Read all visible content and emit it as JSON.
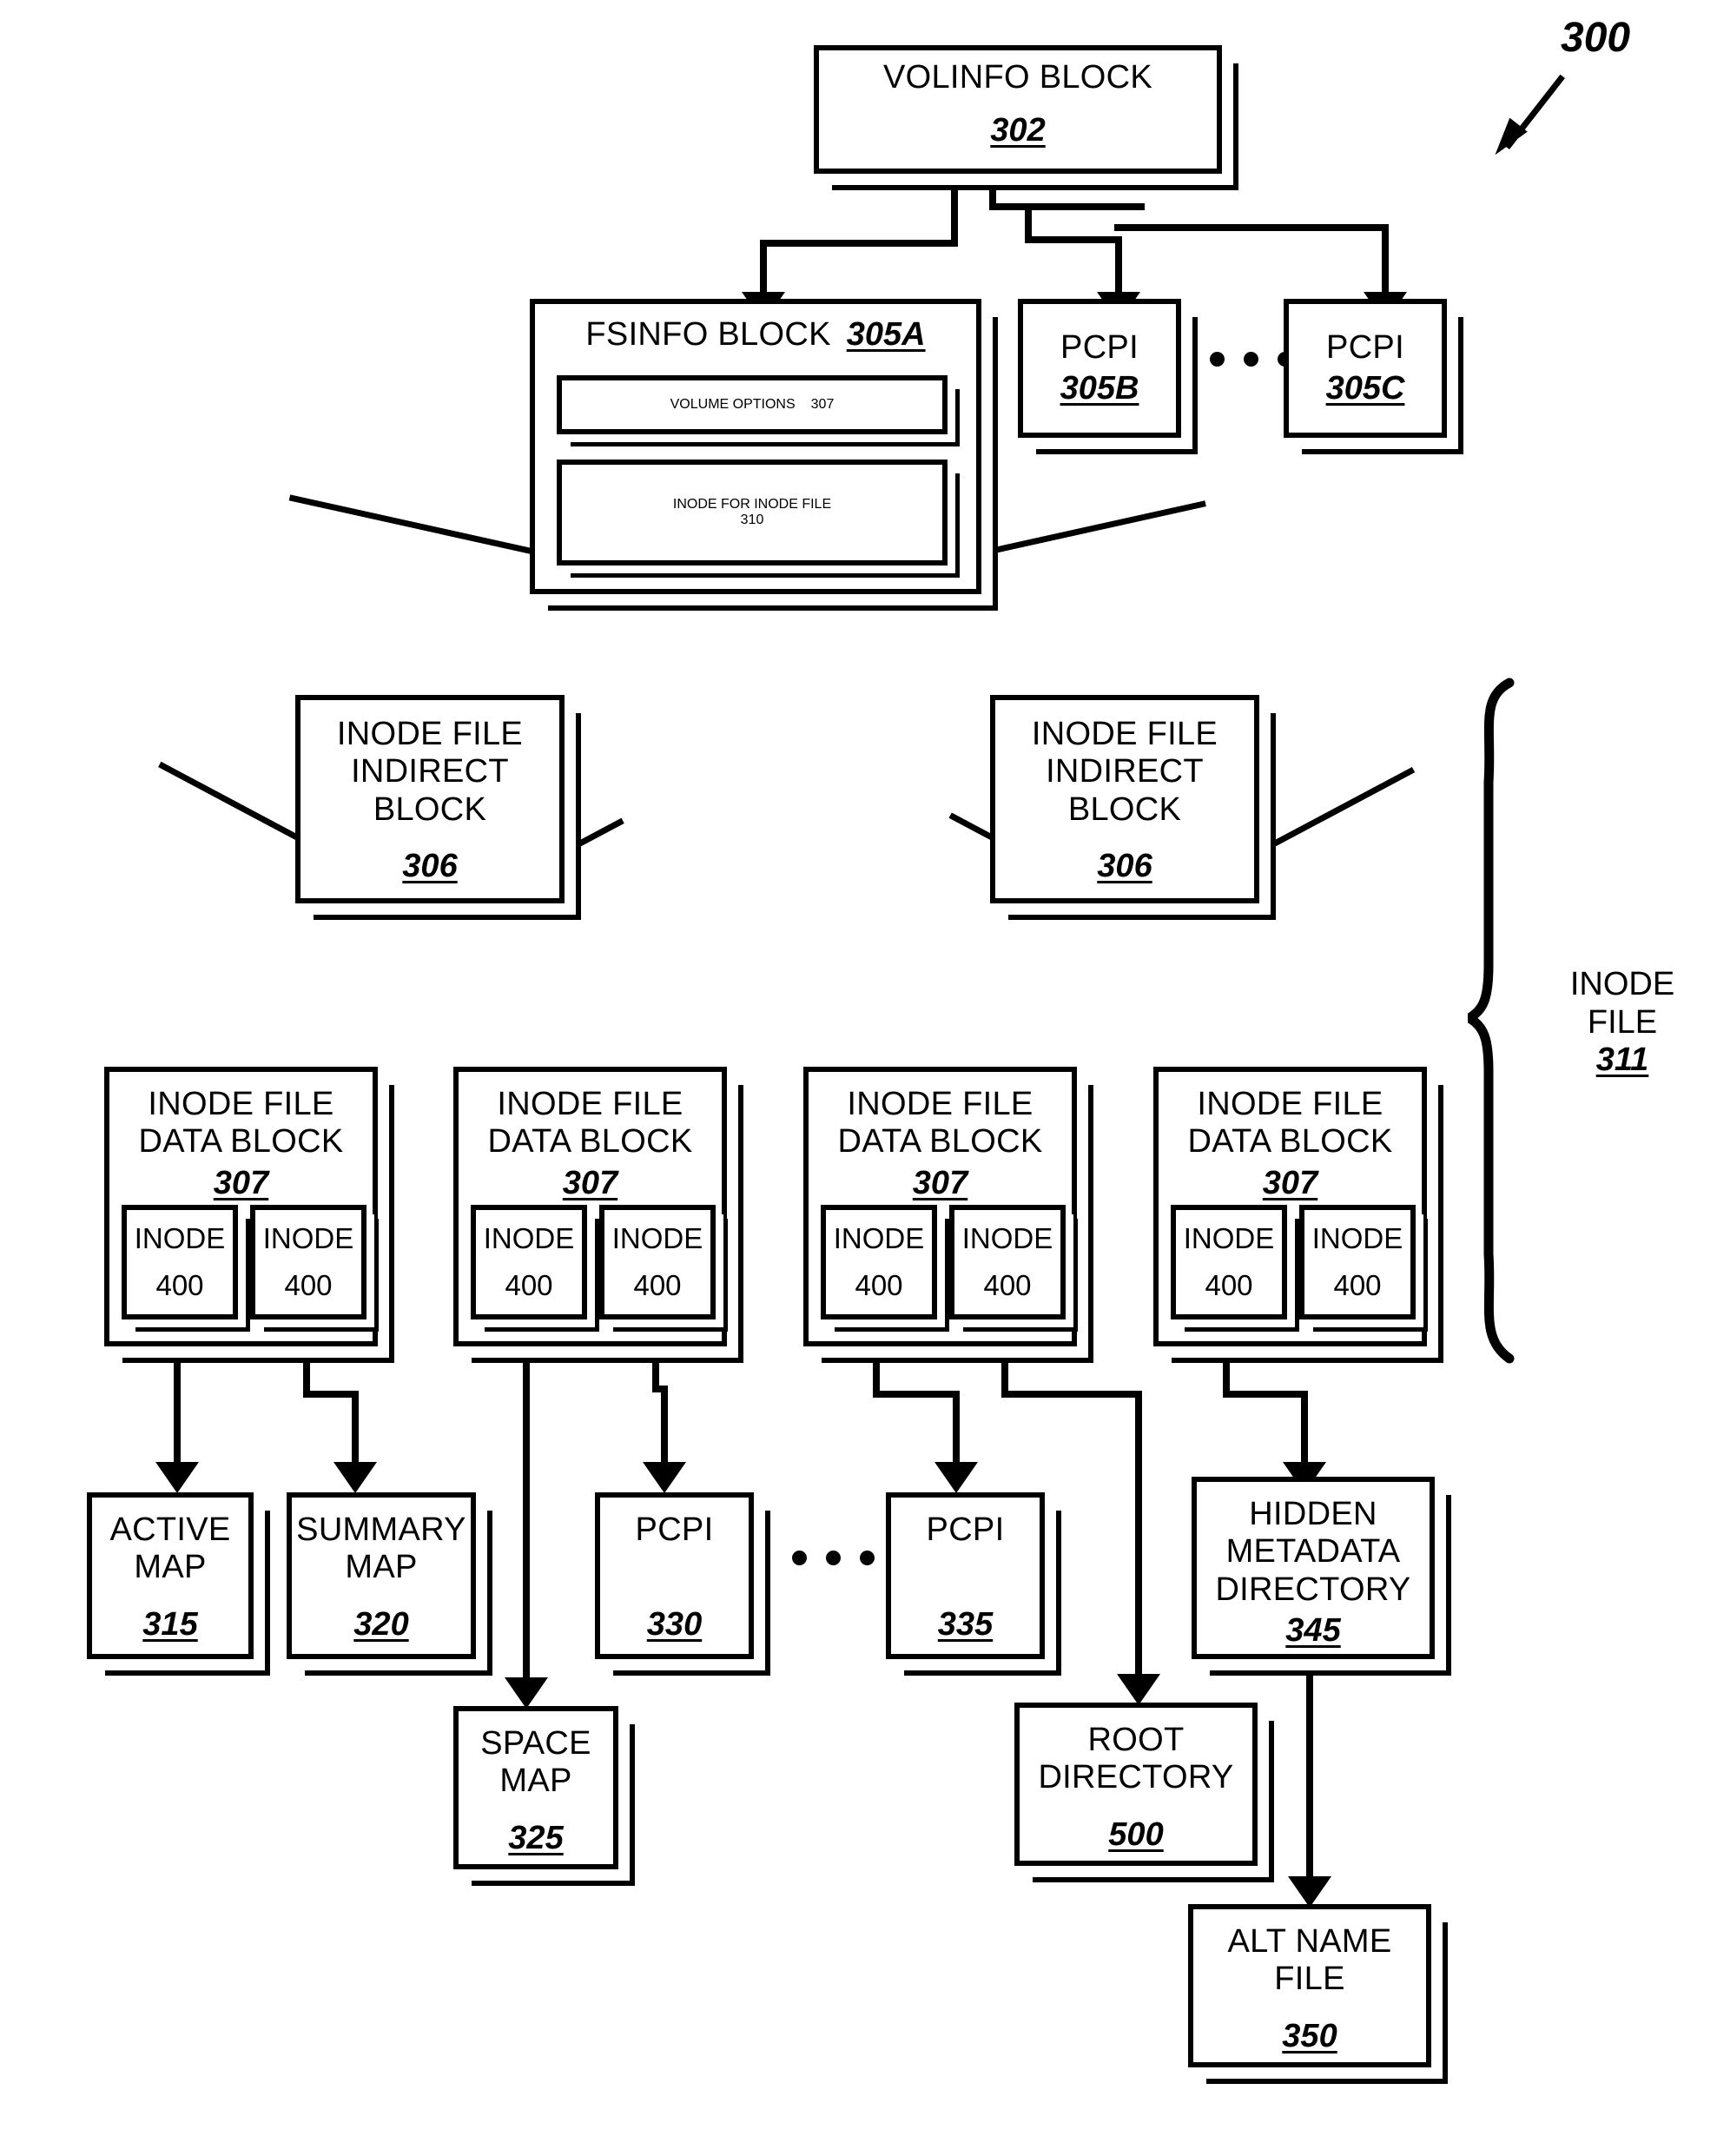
{
  "figure": {
    "number": "300",
    "leader_icon": "diagonal-arrow-icon"
  },
  "nodes": {
    "volinfo": {
      "title": "VOLINFO BLOCK",
      "ref": "302"
    },
    "fsinfo": {
      "title": "FSINFO BLOCK",
      "ref": "305A"
    },
    "volume_options": {
      "title": "VOLUME OPTIONS",
      "ref": "307"
    },
    "inode_for_inode_file": {
      "title": "INODE FOR INODE FILE",
      "ref": "310"
    },
    "pcpi_305b": {
      "title": "PCPI",
      "ref": "305B"
    },
    "pcpi_305c": {
      "title": "PCPI",
      "ref": "305C"
    },
    "indirect_block_1": {
      "title": "INODE FILE\nINDIRECT\nBLOCK",
      "ref": "306"
    },
    "indirect_block_2": {
      "title": "INODE FILE\nINDIRECT\nBLOCK",
      "ref": "306"
    },
    "data_block_1": {
      "title": "INODE FILE\nDATA BLOCK",
      "ref": "307"
    },
    "data_block_2": {
      "title": "INODE FILE\nDATA BLOCK",
      "ref": "307"
    },
    "data_block_3": {
      "title": "INODE FILE\nDATA BLOCK",
      "ref": "307"
    },
    "data_block_4": {
      "title": "INODE FILE\nDATA BLOCK",
      "ref": "307"
    },
    "inode_1a": {
      "title": "INODE",
      "ref": "400"
    },
    "inode_1b": {
      "title": "INODE",
      "ref": "400"
    },
    "inode_2a": {
      "title": "INODE",
      "ref": "400"
    },
    "inode_2b": {
      "title": "INODE",
      "ref": "400"
    },
    "inode_3a": {
      "title": "INODE",
      "ref": "400"
    },
    "inode_3b": {
      "title": "INODE",
      "ref": "400"
    },
    "inode_4a": {
      "title": "INODE",
      "ref": "400"
    },
    "inode_4b": {
      "title": "INODE",
      "ref": "400"
    },
    "active_map": {
      "title": "ACTIVE\nMAP",
      "ref": "315"
    },
    "summary_map": {
      "title": "SUMMARY\nMAP",
      "ref": "320"
    },
    "pcpi_330": {
      "title": "PCPI",
      "ref": "330"
    },
    "pcpi_335": {
      "title": "PCPI",
      "ref": "335"
    },
    "hidden_metadata_directory": {
      "title": "HIDDEN\nMETADATA\nDIRECTORY",
      "ref": "345"
    },
    "space_map": {
      "title": "SPACE\nMAP",
      "ref": "325"
    },
    "root_directory": {
      "title": "ROOT\nDIRECTORY",
      "ref": "500"
    },
    "alt_name_file": {
      "title": "ALT NAME\nFILE",
      "ref": "350"
    }
  },
  "brace_label": {
    "title": "INODE\nFILE",
    "ref": "311"
  },
  "ellipsis": {
    "glyph": "• • •"
  },
  "colors": {
    "ink": "#000000",
    "paper": "#ffffff"
  }
}
